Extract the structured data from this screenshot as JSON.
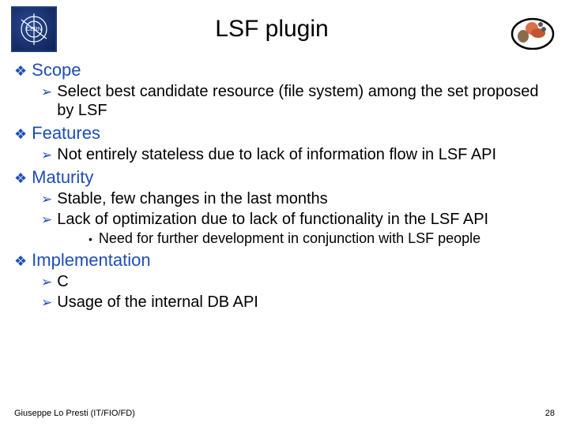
{
  "title": "LSF plugin",
  "sections": [
    {
      "heading": "Scope",
      "items": [
        {
          "text": "Select best candidate resource (file system) among the set proposed by LSF"
        }
      ]
    },
    {
      "heading": "Features",
      "items": [
        {
          "text": "Not entirely stateless due to lack of information flow in LSF API"
        }
      ]
    },
    {
      "heading": "Maturity",
      "items": [
        {
          "text": "Stable, few changes in the last months"
        },
        {
          "text": "Lack of optimization due to lack of functionality in the LSF API",
          "subitems": [
            "Need for further development in conjunction with LSF people"
          ]
        }
      ]
    },
    {
      "heading": "Implementation",
      "items": [
        {
          "text": "C"
        },
        {
          "text": "Usage of the internal DB API"
        }
      ]
    }
  ],
  "footer": {
    "left": "Giuseppe Lo Presti (IT/FIO/FD)",
    "right": "28"
  }
}
